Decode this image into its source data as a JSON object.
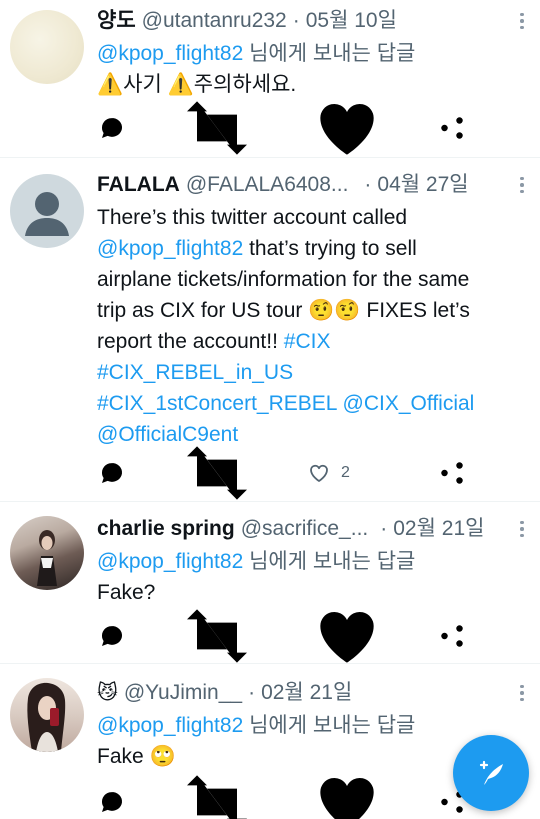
{
  "tweets": [
    {
      "name": "양도",
      "handle": "@utantanru232",
      "separator": "·",
      "date": "05월 10일",
      "reply_to_handle": "@kpop_flight82",
      "reply_to_suffix": "님에게 보내는 답글",
      "text_parts": [
        "⚠️",
        "사기 ",
        "⚠️",
        "주의하세요."
      ],
      "likes": ""
    },
    {
      "name": "FALALA",
      "handle": "@FALALA6408...",
      "separator": "·",
      "date": "04월 27일",
      "text_lines": {
        "l1": "There’s this twitter account called",
        "l2_link": "@kpop_flight82",
        "l2_rest": " that’s trying to sell",
        "l3": "airplane tickets/information for the same",
        "l4_pre": "trip as CIX for US tour ",
        "l4_emoji": "🤨🤨",
        "l4_post": " FIXES let’s",
        "l5_pre": "report the account!! ",
        "l5_tag": "#CIX",
        "l6_tag": "#CIX_REBEL_in_US",
        "l7_tag": "#CIX_1stConcert_REBEL",
        "l7_mention": "@CIX_Official",
        "l8_mention": "@OfficialC9ent"
      },
      "likes": "2"
    },
    {
      "name": "charlie spring",
      "handle": "@sacrifice_...",
      "separator": "·",
      "date": "02월 21일",
      "reply_to_handle": "@kpop_flight82",
      "reply_to_suffix": "님에게 보내는 답글",
      "text": "Fake?",
      "likes": ""
    },
    {
      "name_emoji": "😼",
      "handle": "@YuJimin__",
      "separator": "·",
      "date": "02월 21일",
      "reply_to_handle": "@kpop_flight82",
      "reply_to_suffix": "님에게 보내는 답글",
      "text": "Fake",
      "text_emoji": "🙄",
      "likes": ""
    }
  ],
  "icons": [
    "reply-icon",
    "retweet-icon",
    "like-icon",
    "share-icon",
    "more-icon",
    "compose-icon"
  ],
  "colors": {
    "link": "#1d9bf0",
    "muted": "#536471",
    "fab": "#1d9bf0",
    "divider": "#eff3f4"
  }
}
